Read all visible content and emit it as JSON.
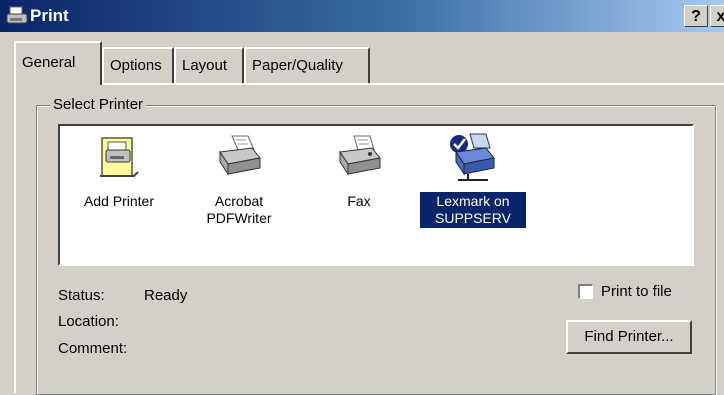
{
  "window": {
    "title": "Print",
    "help_label": "?",
    "close_label": "x"
  },
  "tabs": [
    {
      "label": "General",
      "active": true
    },
    {
      "label": "Options",
      "active": false
    },
    {
      "label": "Layout",
      "active": false
    },
    {
      "label": "Paper/Quality",
      "active": false
    }
  ],
  "select_printer": {
    "group_label": "Select Printer",
    "printers": [
      {
        "label": "Add Printer",
        "icon": "add-printer-icon",
        "selected": false
      },
      {
        "label": "Acrobat PDFWriter",
        "icon": "printer-icon",
        "selected": false
      },
      {
        "label": "Fax",
        "icon": "fax-icon",
        "selected": false
      },
      {
        "label": "Lexmark on SUPPSERV",
        "icon": "network-printer-icon",
        "selected": true
      }
    ],
    "status_label": "Status:",
    "status_value": "Ready",
    "location_label": "Location:",
    "location_value": "",
    "comment_label": "Comment:",
    "comment_value": "",
    "print_to_file_label": "Print to file",
    "print_to_file_checked": false,
    "find_printer_label": "Find Printer..."
  },
  "colors": {
    "titlebar_start": "#0a246a",
    "titlebar_end": "#a6caf0",
    "face": "#d4d0c8",
    "selection": "#0a246a"
  }
}
